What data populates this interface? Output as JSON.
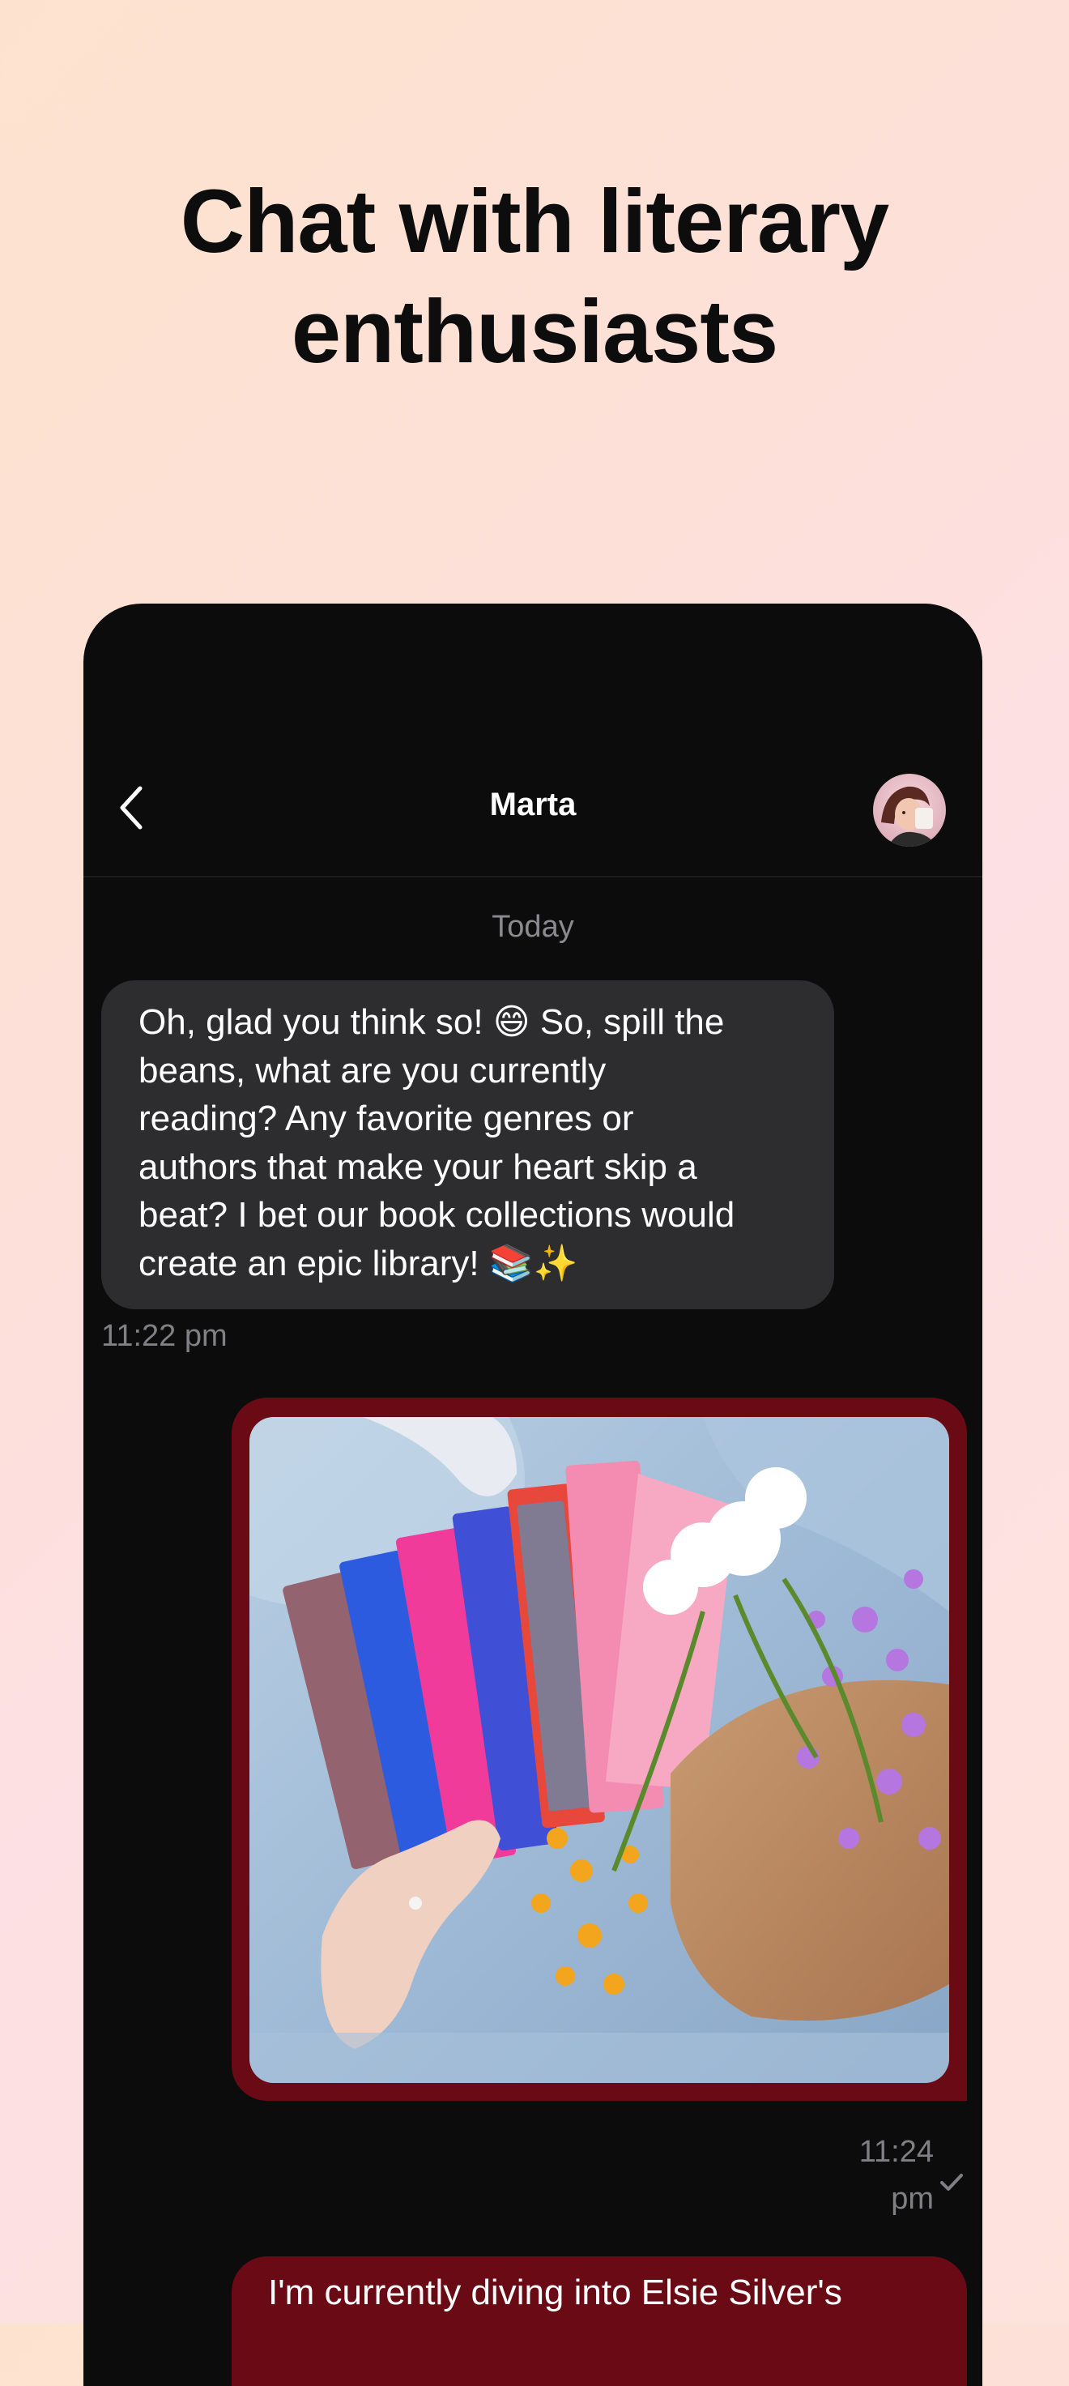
{
  "promo": {
    "headline_line1": "Chat with literary",
    "headline_line2": "enthusiasts"
  },
  "chat": {
    "contact_name": "Marta",
    "day_separator": "Today",
    "messages": [
      {
        "direction": "incoming",
        "lines": [
          "Oh, glad you think so! 😄 So, spill the",
          "beans, what are you currently",
          "reading? Any favorite genres or",
          "authors that make your heart skip a",
          "beat? I bet our book collections would",
          "create an epic library! 📚✨"
        ],
        "time": "11:22 pm"
      },
      {
        "direction": "outgoing",
        "type": "image",
        "time_line1": "11:24",
        "time_line2": "pm",
        "status": "sent"
      },
      {
        "direction": "outgoing",
        "text": "I'm currently diving into Elsie Silver's"
      }
    ]
  },
  "icons": {
    "back": "chevron-left-icon",
    "check": "checkmark-icon"
  },
  "colors": {
    "background_peach": "#fde3cf",
    "background_pink": "#fde0e3",
    "chat_background": "#0c0c0d",
    "incoming_bubble": "#2d2d30",
    "outgoing_bubble": "#6a0a14",
    "timestamp": "#808085"
  }
}
